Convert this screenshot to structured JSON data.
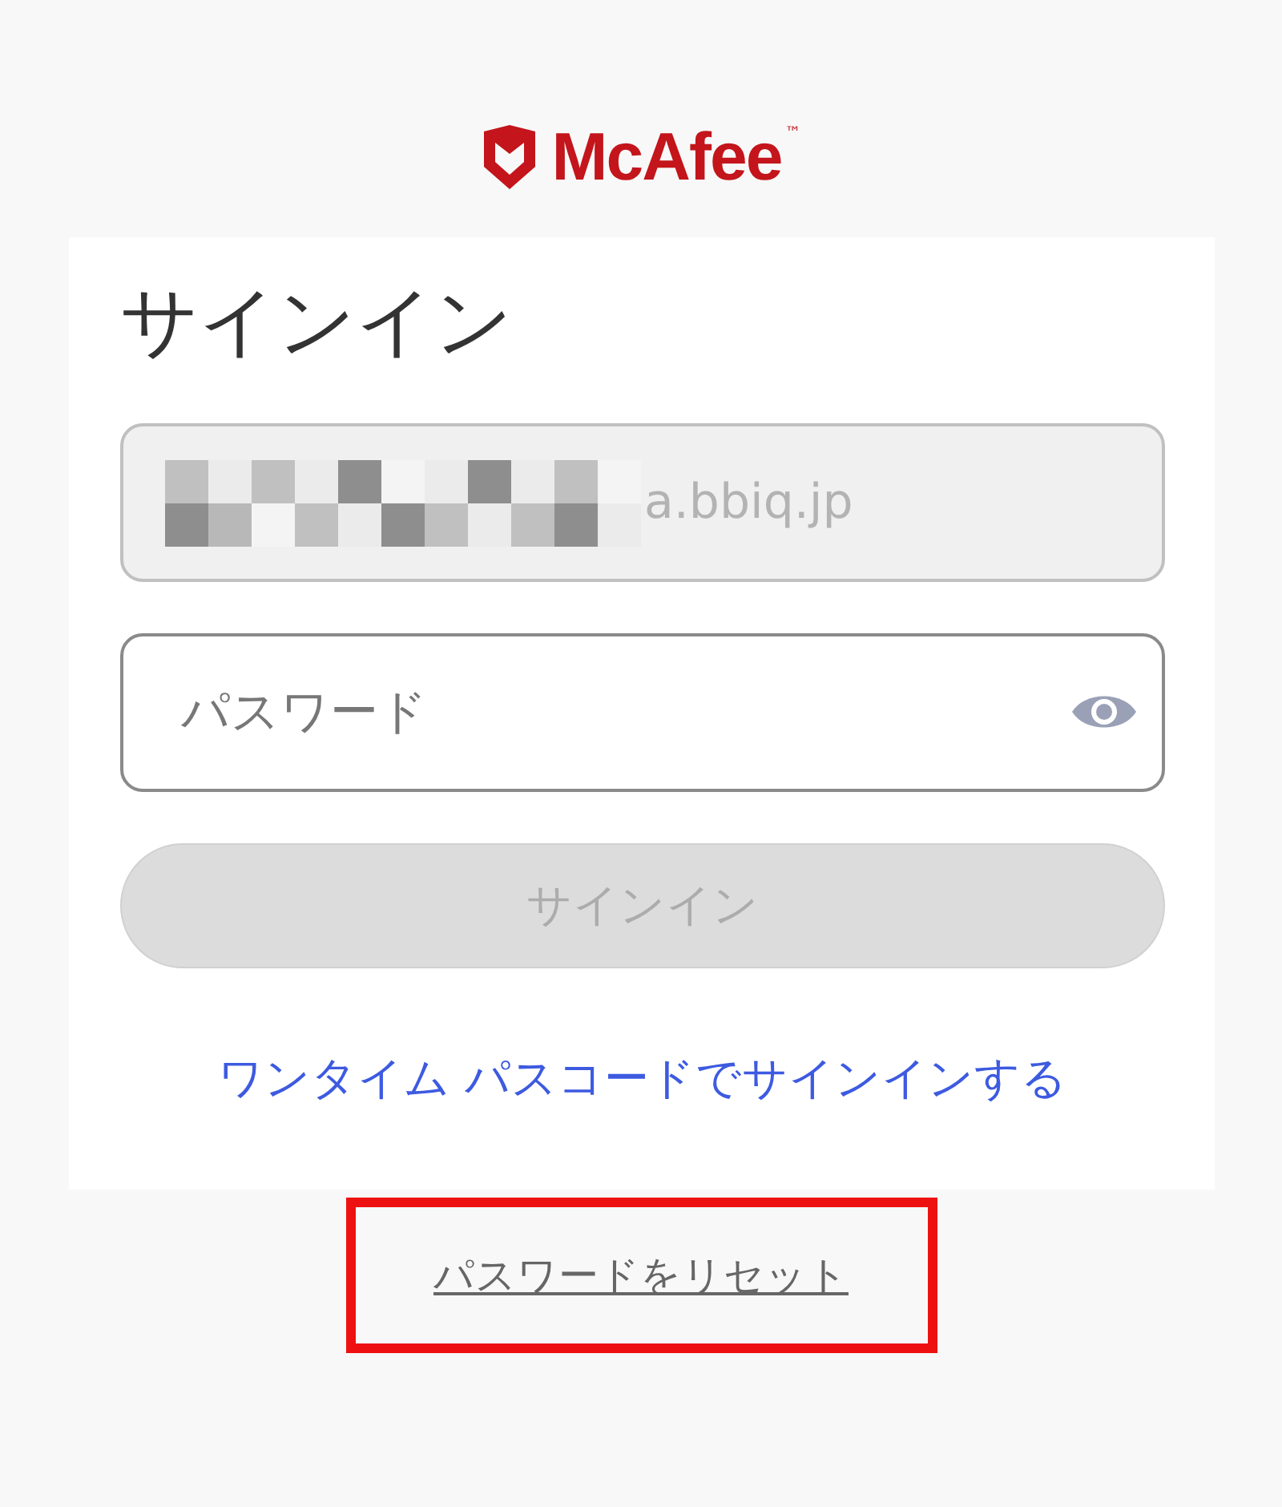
{
  "logo": {
    "wordmark": "McAfee",
    "trademark": "™"
  },
  "title": "サインイン",
  "email_field": {
    "value": "a.bbiq.jp",
    "disabled": true
  },
  "password_field": {
    "placeholder": "パスワード"
  },
  "sign_in_button": {
    "label": "サインイン",
    "disabled": true
  },
  "one_time_link": "ワンタイム パスコードでサインインする",
  "reset_link": {
    "label": "パスワードをリセット",
    "highlighted": true
  }
}
